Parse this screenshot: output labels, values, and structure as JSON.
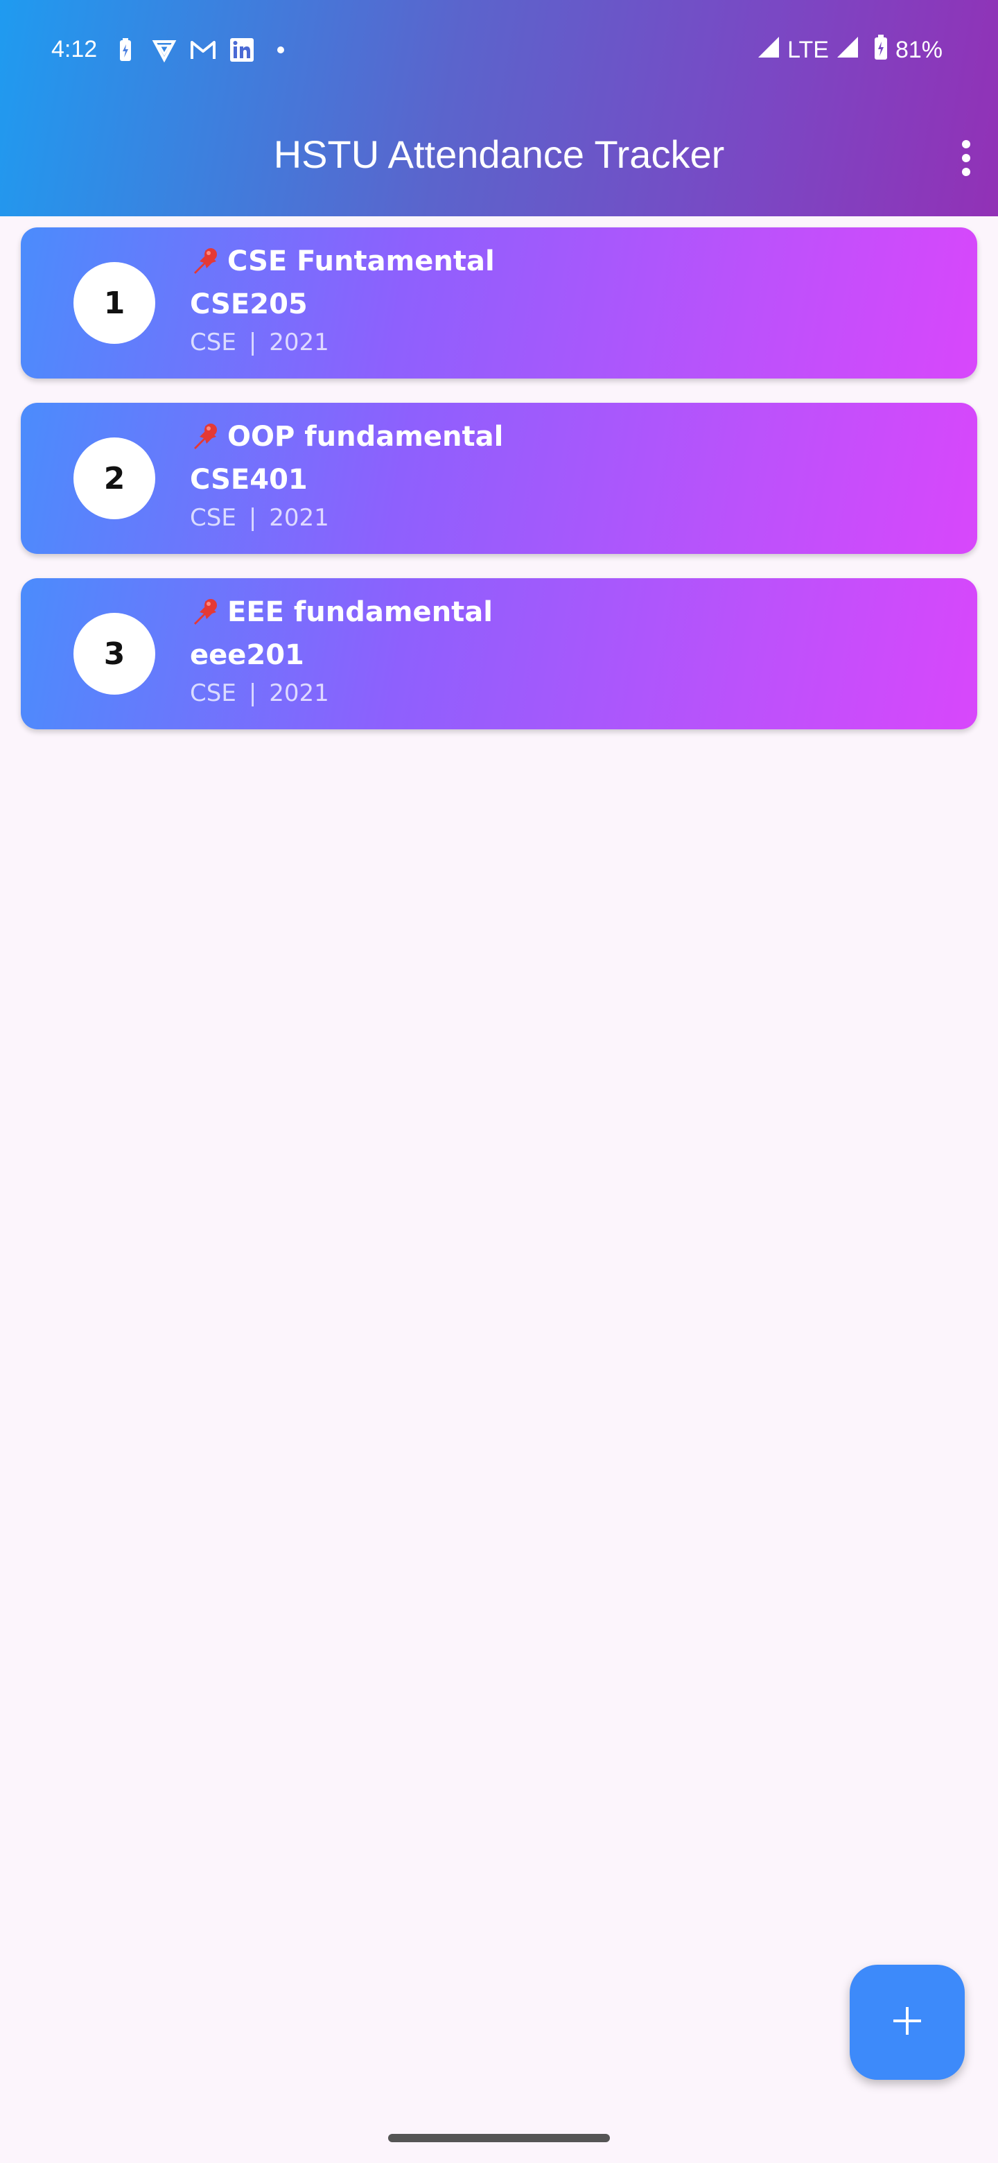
{
  "status_bar": {
    "time": "4:12",
    "network": "LTE",
    "battery": "81%",
    "left_icons": [
      "battery-saver-icon",
      "vpn-icon",
      "gmail-icon",
      "linkedin-icon",
      "dot-icon"
    ],
    "right_icons": [
      "signal-icon",
      "signal-icon",
      "battery-charging-icon"
    ]
  },
  "app_bar": {
    "title": "HSTU Attendance Tracker",
    "menu_icon": "more-vert-icon"
  },
  "courses": [
    {
      "index": "1",
      "title": "CSE Funtamental",
      "code": "CSE205",
      "dept": "CSE",
      "separator": "|",
      "year": "2021"
    },
    {
      "index": "2",
      "title": "OOP fundamental",
      "code": "CSE401",
      "dept": "CSE",
      "separator": "|",
      "year": "2021"
    },
    {
      "index": "3",
      "title": "EEE fundamental",
      "code": "eee201",
      "dept": "CSE",
      "separator": "|",
      "year": "2021"
    }
  ],
  "fab": {
    "icon": "plus-icon"
  },
  "colors": {
    "header_start": "#1f9bf0",
    "header_end": "#9231b6",
    "card_start": "#4b8cfc",
    "card_end": "#d847fb",
    "fab": "#3d8afa",
    "background": "#fcf5fc"
  }
}
